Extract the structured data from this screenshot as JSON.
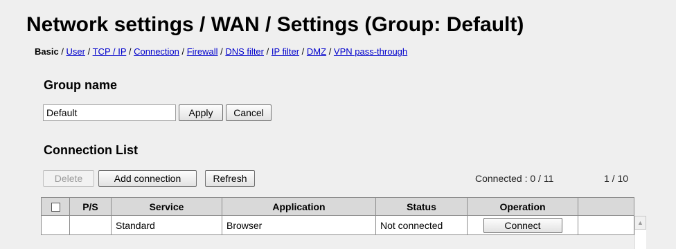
{
  "header": {
    "title": "Network settings / WAN / Settings (Group: Default)"
  },
  "breadcrumb": {
    "current": "Basic",
    "separator": " / ",
    "links": [
      "User",
      "TCP / IP",
      "Connection",
      "Firewall",
      "DNS filter",
      "IP filter",
      "DMZ",
      "VPN pass-through"
    ]
  },
  "group": {
    "title": "Group name",
    "input_value": "Default",
    "apply_label": "Apply",
    "cancel_label": "Cancel"
  },
  "connection_list": {
    "title": "Connection List",
    "delete_label": "Delete",
    "add_label": "Add connection",
    "refresh_label": "Refresh",
    "connected_text": "Connected : 0 / 11",
    "page_text": "1 / 10",
    "columns": [
      "P/S",
      "Service",
      "Application",
      "Status",
      "Operation"
    ],
    "rows": [
      {
        "ps": "",
        "service": "Standard",
        "application": "Browser",
        "status": "Not connected",
        "operation_label": "Connect"
      }
    ]
  },
  "icons": {
    "scroll_up": "scroll-up-arrow-icon",
    "checkbox": "checkbox-icon"
  },
  "colors": {
    "background": "#efefef",
    "link": "#0000cc",
    "header_cell": "#d9d9d9"
  }
}
